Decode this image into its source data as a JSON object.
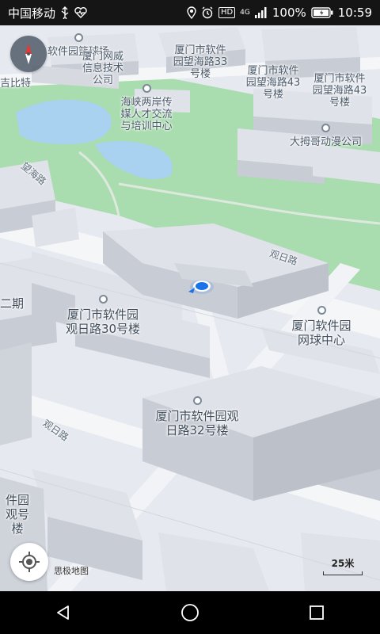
{
  "status_bar": {
    "carrier": "中国移动",
    "network_type": "4G",
    "battery": "100%",
    "time": "10:59",
    "hd": "HD"
  },
  "map": {
    "labels": {
      "software_park_basketball": "软件园篮球场",
      "wangshi_tech": "厦门网威信息技术公司",
      "wanghai_33": "厦门市软件园望海路33号楼",
      "wanghai_43": "厦门市软件园望海路43号楼",
      "wanghai_43_right": "厦门市软件园望海路43号楼",
      "jibili": "吉比特",
      "cross_strait": "海峡两岸传媒人才交流与培训中心",
      "daimuge": "大拇哥动漫公司",
      "guanri_30": "厦门市软件园观日路30号楼",
      "tennis_center": "厦门软件园网球中心",
      "guanri_32": "厦门市软件园观日路32号楼",
      "phase_two": "二期",
      "edge_bottom_left": "件园观号楼",
      "road_guanri_right": "观日路",
      "road_guanri_left": "观日路",
      "road_wanghai": "望海路"
    },
    "credit": "思极地图",
    "scale_label": "25米"
  },
  "colors": {
    "water": "#a8d2f0",
    "green": "#a9dcae",
    "road": "#f6f7f9",
    "building_top": "#dfe2e8",
    "building_side": "#c8ccd4",
    "location": "#1a73e8"
  },
  "icons": {
    "compass": "compass-icon",
    "locate": "crosshair-icon",
    "back": "back-triangle-icon",
    "home": "home-circle-icon",
    "recents": "recents-square-icon"
  }
}
